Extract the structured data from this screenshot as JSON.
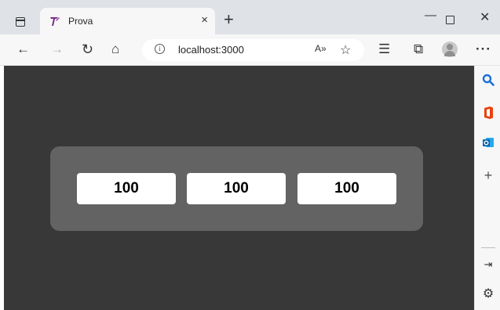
{
  "browser": {
    "tab": {
      "title": "Prova",
      "close_icon": "×"
    },
    "new_tab_icon": "+",
    "window": {
      "minimize": "—",
      "close": "✕"
    },
    "toolbar": {
      "back_icon": "←",
      "forward_icon": "→",
      "reload_icon": "↻",
      "home_icon": "⌂",
      "url": "localhost:3000",
      "info_icon": "i",
      "read_aloud_icon": "A»",
      "add_favorite_icon": "☆",
      "favorites_icon": "☰",
      "collections_icon": "⧉",
      "more_icon": "···"
    },
    "sidebar": {
      "search_icon": "🔍",
      "add_icon": "+",
      "hide_icon": "⇥",
      "settings_icon": "⚙"
    }
  },
  "page": {
    "values": [
      "100",
      "100",
      "100"
    ]
  },
  "colors": {
    "content_bg": "#383838",
    "panel_bg": "#636363",
    "box_bg": "#ffffff"
  }
}
